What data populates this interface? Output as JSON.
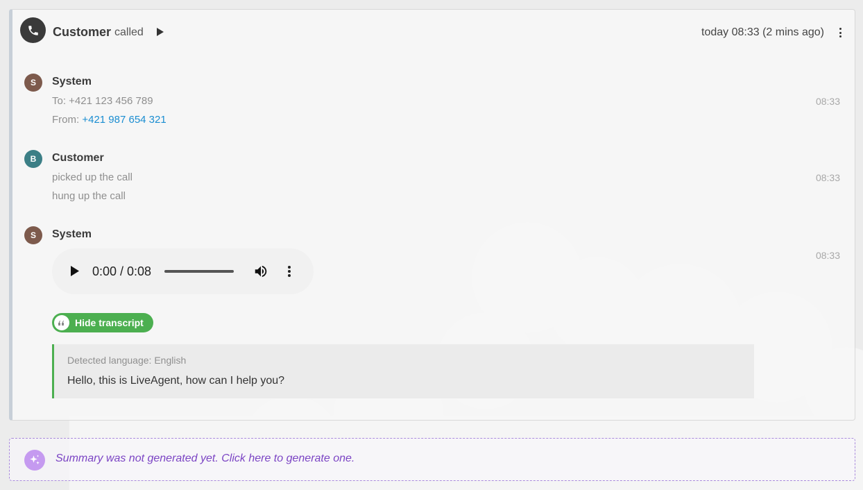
{
  "header": {
    "caller": "Customer",
    "action": "called",
    "time": "today 08:33 (2 mins ago)"
  },
  "messages": [
    {
      "avatar_letter": "S",
      "avatar_color": "#7d5a4c",
      "sender": "System",
      "time": "08:33",
      "to_label": "To: +421 123 456 789",
      "from_label": "From: ",
      "from_number": "+421 987 654 321"
    },
    {
      "avatar_letter": "B",
      "avatar_color": "#3c7f86",
      "sender": "Customer",
      "time": "08:33",
      "line1": "picked up the call",
      "line2": "hung up the call"
    },
    {
      "avatar_letter": "S",
      "avatar_color": "#7d5a4c",
      "sender": "System",
      "time": "08:33"
    }
  ],
  "audio": {
    "time": "0:00 / 0:08"
  },
  "transcript": {
    "toggle_label": "Hide transcript",
    "detected_language": "Detected language: English",
    "text": "Hello, this is LiveAgent, how can I help you?"
  },
  "summary": {
    "text": "Summary was not generated yet. Click here to generate one."
  },
  "colors": {
    "accent_green": "#4caf50",
    "link_blue": "#1a8dd1",
    "summary_purple": "#7b44c4"
  },
  "icons": [
    "phone-icon",
    "play-icon",
    "more-vertical-icon",
    "volume-icon",
    "quote-icon",
    "sparkle-icon"
  ]
}
